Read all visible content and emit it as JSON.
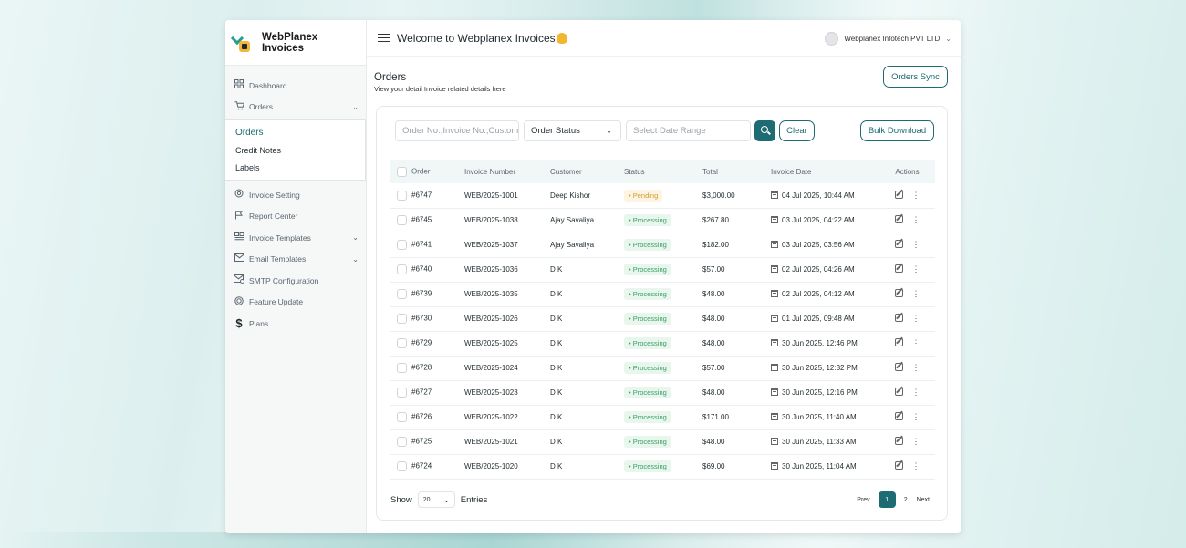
{
  "brand": {
    "line1": "WebPlanex",
    "line2": "Invoices"
  },
  "sidebar": {
    "items": [
      {
        "label": "Dashboard",
        "icon": "grid-icon"
      },
      {
        "label": "Orders",
        "icon": "cart-icon",
        "expanded": true,
        "children": [
          {
            "label": "Orders",
            "active": true
          },
          {
            "label": "Credit Notes"
          },
          {
            "label": "Labels"
          }
        ]
      },
      {
        "label": "Invoice Setting",
        "icon": "gear-icon"
      },
      {
        "label": "Report Center",
        "icon": "flag-icon"
      },
      {
        "label": "Invoice Templates",
        "icon": "template-icon",
        "has_children": true
      },
      {
        "label": "Email Templates",
        "icon": "mail-icon",
        "has_children": true
      },
      {
        "label": "SMTP Configuration",
        "icon": "mail-settings-icon"
      },
      {
        "label": "Feature Update",
        "icon": "badge-icon"
      },
      {
        "label": "Plans",
        "icon": "dollar-icon"
      }
    ]
  },
  "topbar": {
    "welcome": "Welcome to Webplanex Invoices",
    "user": "Webplanex Infotech PVT LTD"
  },
  "page": {
    "title": "Orders",
    "subtitle": "View your detail Invoice related details here",
    "sync_label": "Orders Sync"
  },
  "filters": {
    "search_placeholder": "Order No.,Invoice No.,Customer",
    "status_label": "Order Status",
    "date_placeholder": "Select Date Range",
    "clear_label": "Clear",
    "bulk_label": "Bulk Download"
  },
  "table": {
    "headers": [
      "Order",
      "Invoice Number",
      "Customer",
      "Status",
      "Total",
      "Invoice Date",
      "Actions"
    ],
    "rows": [
      {
        "order": "#6747",
        "invoice": "WEB/2025-1001",
        "customer": "Deep Kishor",
        "status": "Pending",
        "total": "$3,000.00",
        "date": "04 Jul 2025, 10:44 AM"
      },
      {
        "order": "#6745",
        "invoice": "WEB/2025-1038",
        "customer": "Ajay Savaliya",
        "status": "Processing",
        "total": "$267.80",
        "date": "03 Jul 2025, 04:22 AM"
      },
      {
        "order": "#6741",
        "invoice": "WEB/2025-1037",
        "customer": "Ajay Savaliya",
        "status": "Processing",
        "total": "$182.00",
        "date": "03 Jul 2025, 03:56 AM"
      },
      {
        "order": "#6740",
        "invoice": "WEB/2025-1036",
        "customer": "D K",
        "status": "Processing",
        "total": "$57.00",
        "date": "02 Jul 2025, 04:26 AM"
      },
      {
        "order": "#6739",
        "invoice": "WEB/2025-1035",
        "customer": "D K",
        "status": "Processing",
        "total": "$48.00",
        "date": "02 Jul 2025, 04:12 AM"
      },
      {
        "order": "#6730",
        "invoice": "WEB/2025-1026",
        "customer": "D K",
        "status": "Processing",
        "total": "$48.00",
        "date": "01 Jul 2025, 09:48 AM"
      },
      {
        "order": "#6729",
        "invoice": "WEB/2025-1025",
        "customer": "D K",
        "status": "Processing",
        "total": "$48.00",
        "date": "30 Jun 2025, 12:46 PM"
      },
      {
        "order": "#6728",
        "invoice": "WEB/2025-1024",
        "customer": "D K",
        "status": "Processing",
        "total": "$57.00",
        "date": "30 Jun 2025, 12:32 PM"
      },
      {
        "order": "#6727",
        "invoice": "WEB/2025-1023",
        "customer": "D K",
        "status": "Processing",
        "total": "$48.00",
        "date": "30 Jun 2025, 12:16 PM"
      },
      {
        "order": "#6726",
        "invoice": "WEB/2025-1022",
        "customer": "D K",
        "status": "Processing",
        "total": "$171.00",
        "date": "30 Jun 2025, 11:40 AM"
      },
      {
        "order": "#6725",
        "invoice": "WEB/2025-1021",
        "customer": "D K",
        "status": "Processing",
        "total": "$48.00",
        "date": "30 Jun 2025, 11:33 AM"
      },
      {
        "order": "#6724",
        "invoice": "WEB/2025-1020",
        "customer": "D K",
        "status": "Processing",
        "total": "$69.00",
        "date": "30 Jun 2025, 11:04 AM"
      }
    ]
  },
  "footer": {
    "show_label": "Show",
    "show_value": "20",
    "entries_label": "Entries",
    "prev_label": "Prev",
    "pages": [
      "1",
      "2"
    ],
    "current_page": "1",
    "next_label": "Next"
  },
  "colors": {
    "accent": "#1d6b73",
    "pending": "#d49a2a",
    "processing": "#3aa063"
  }
}
